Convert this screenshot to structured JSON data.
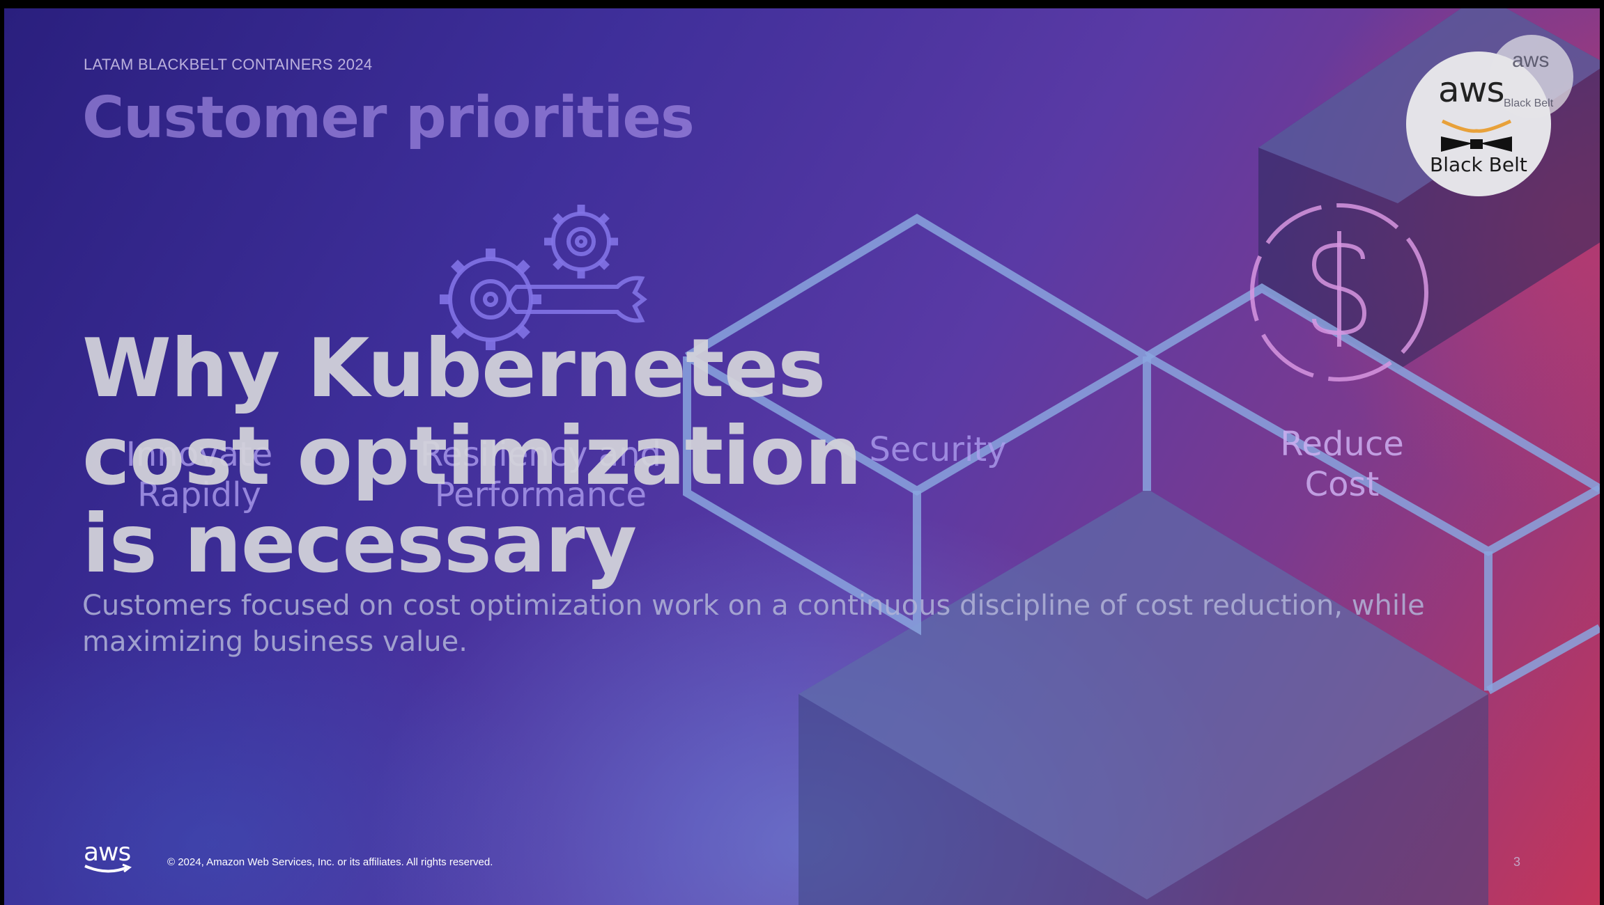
{
  "slide": {
    "eyebrow": "LATAM BLACKBELT CONTAINERS 2024",
    "ghost_title": "Customer priorities",
    "priorities": [
      {
        "line1": "Innovate",
        "line2": "Rapidly"
      },
      {
        "line1": "Resiliency and",
        "line2": "Performance"
      },
      {
        "line1": "Security",
        "line2": ""
      },
      {
        "line1": "Reduce",
        "line2": "Cost"
      }
    ],
    "title_lines": [
      "Why Kubernetes",
      "cost optimization",
      "is necessary"
    ],
    "subtitle": "Customers focused on cost optimization work on a continuous discipline of cost reduction, while maximizing business value.",
    "page_number": "3"
  },
  "badge": {
    "brand": "aws",
    "label": "Black Belt",
    "small_brand": "aws",
    "small_label": "Black Belt"
  },
  "footer": {
    "logo": "aws",
    "copyright": "© 2024, Amazon Web Services, Inc. or its affiliates. All rights reserved."
  },
  "icons": [
    "gears-wrench-icon",
    "dollar-circle-icon",
    "black-belt-icon"
  ],
  "colors": {
    "background_start": "#2a1f7e",
    "background_end": "#c4365a",
    "outline": "#8aa4de",
    "title": "#d4d4da"
  }
}
